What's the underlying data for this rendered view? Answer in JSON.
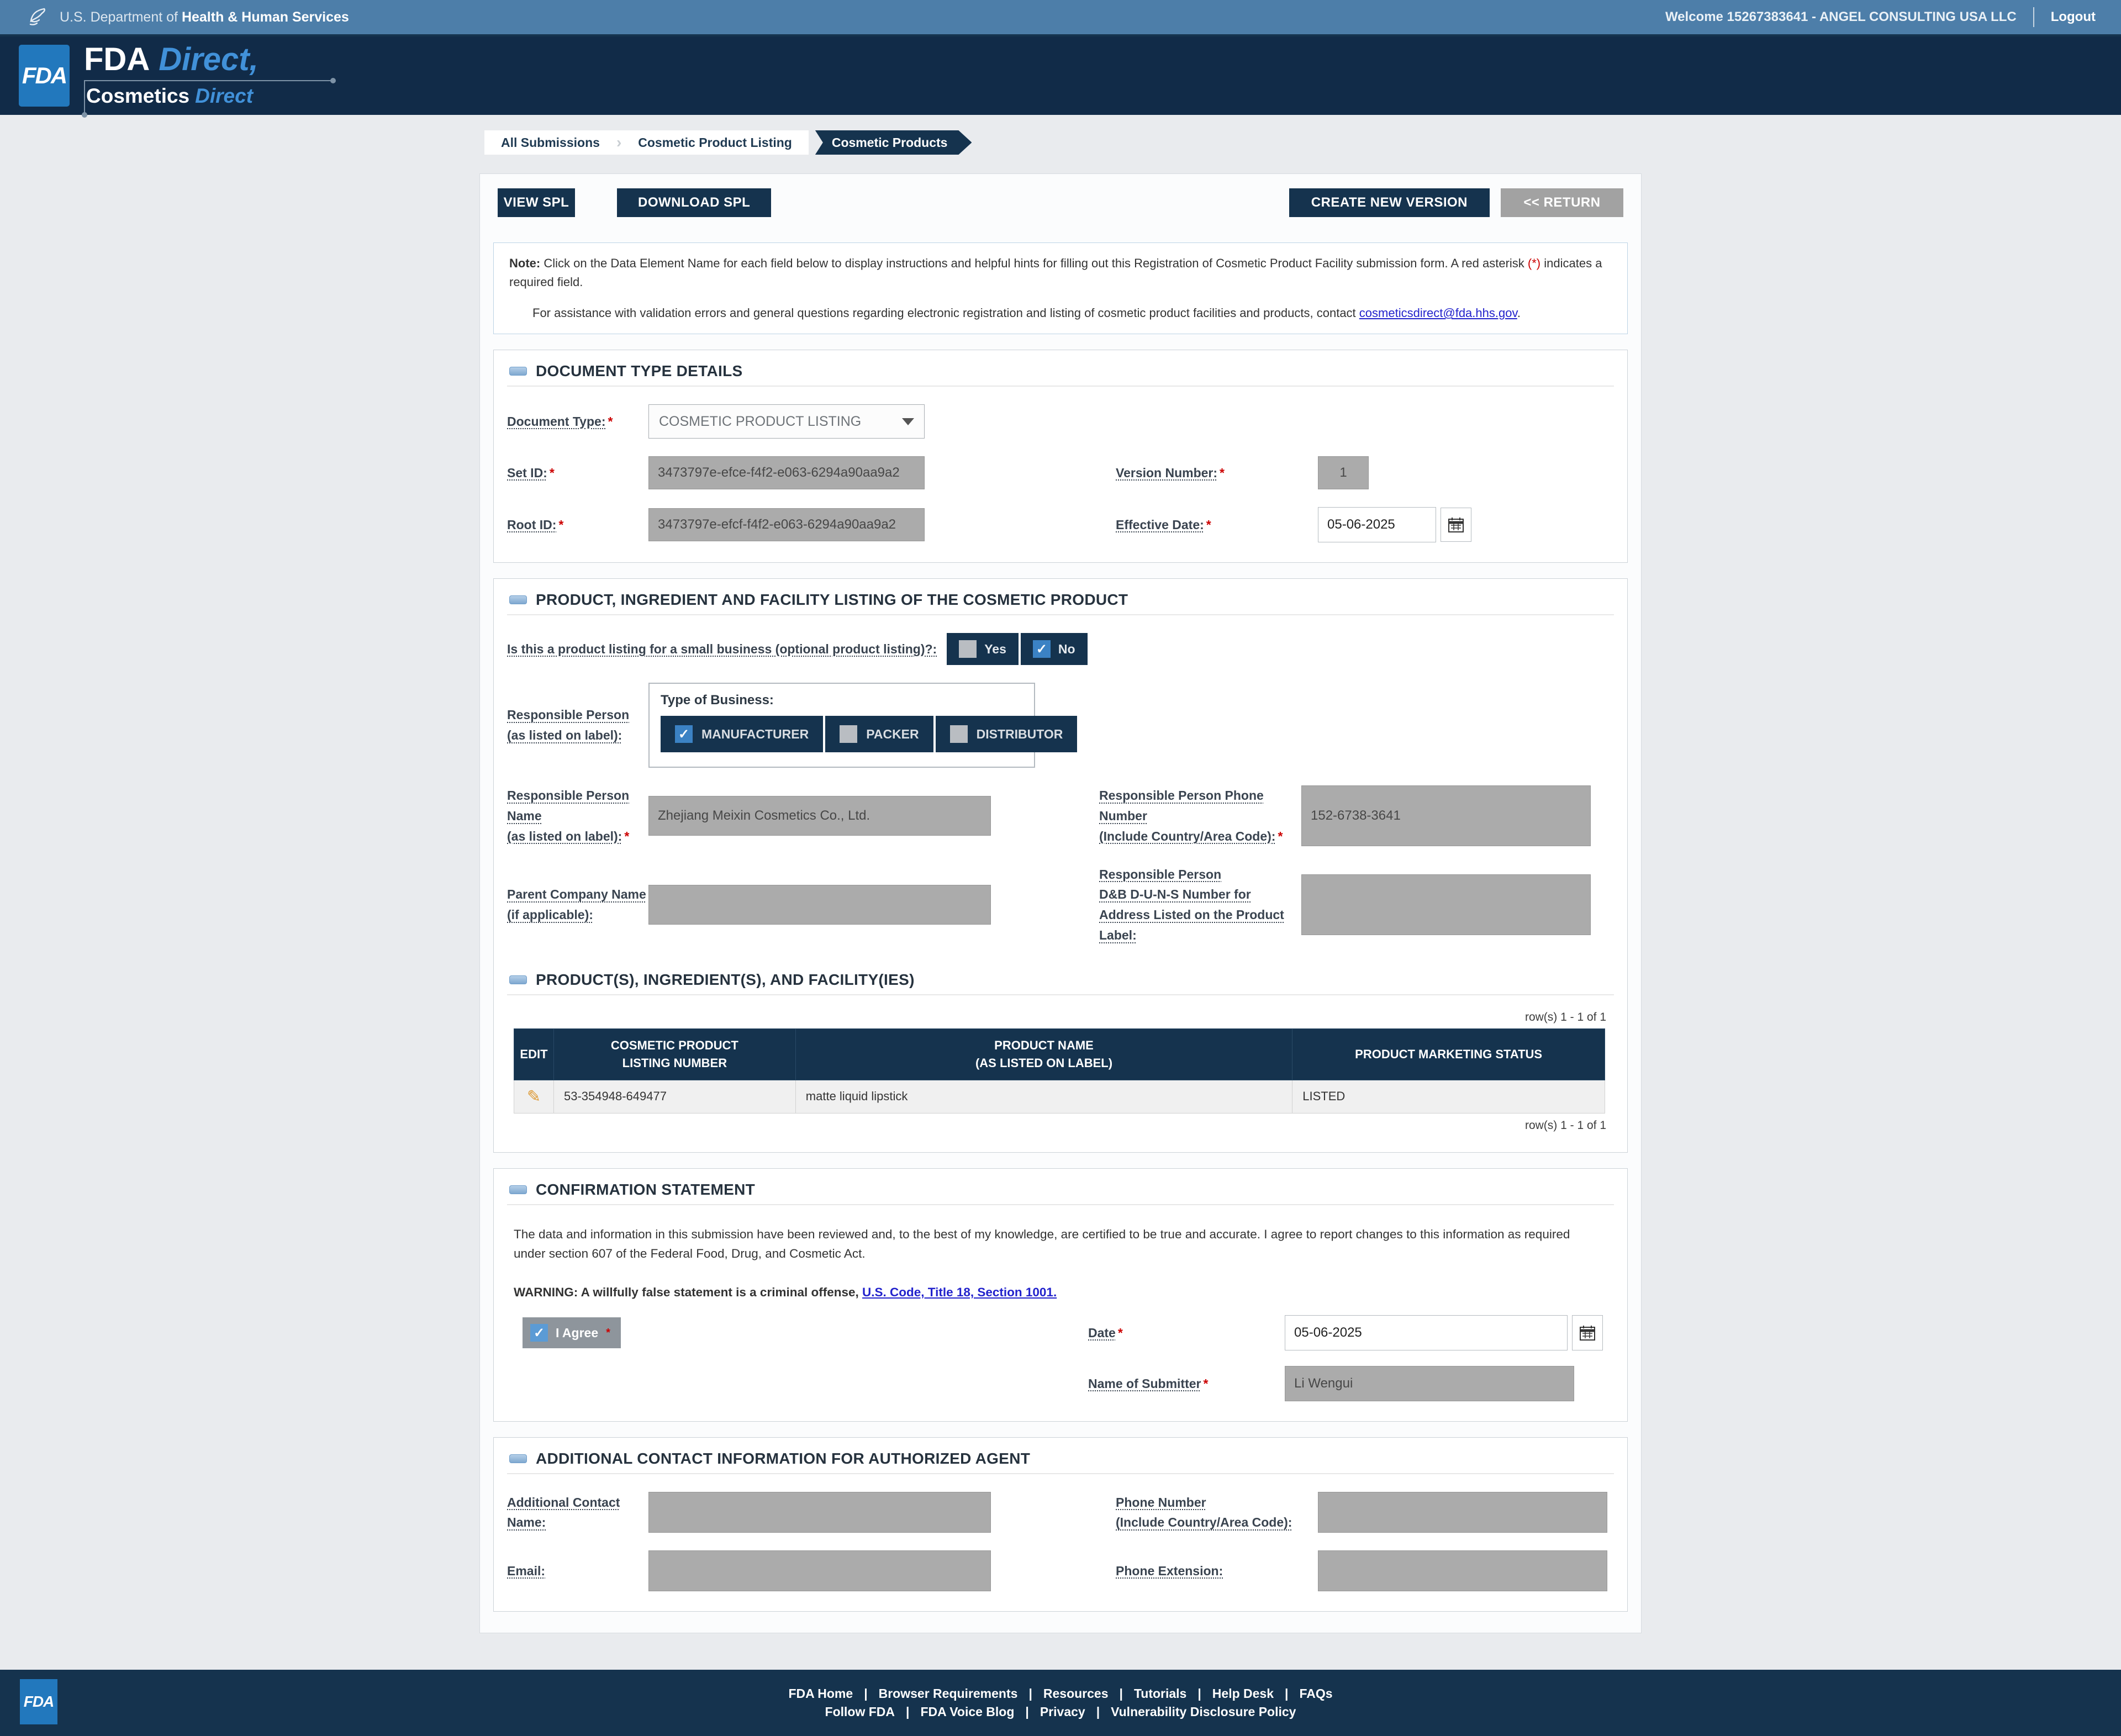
{
  "topbar": {
    "dept_prefix": "U.S. Department of",
    "dept_bold": "Health & Human Services",
    "welcome": "Welcome 15267383641 - ANGEL CONSULTING USA LLC",
    "logout": "Logout"
  },
  "brand": {
    "logo": "FDA",
    "title_main": "FDA",
    "title_direct": "Direct,",
    "subtitle_main": "Cosmetics",
    "subtitle_direct": "Direct"
  },
  "crumbs": {
    "all": "All Submissions",
    "listing": "Cosmetic Product Listing",
    "active": "Cosmetic Products",
    "sep": "›"
  },
  "toolbar": {
    "view": "VIEW SPL",
    "download": "DOWNLOAD SPL",
    "create": "CREATE NEW VERSION",
    "return": "<< RETURN"
  },
  "note": {
    "prefix": "Note:",
    "body1": " Click on the Data Element Name for each field below to display instructions and helpful hints for filling out this Registration of Cosmetic Product Facility submission form. A red asterisk ",
    "red": "(*)",
    "body2": " indicates a required field.",
    "help": "For assistance with validation errors and general questions regarding electronic registration and listing of cosmetic product facilities and products, contact ",
    "help_link": "cosmeticsdirect@fda.hhs.gov",
    "dot": "."
  },
  "doc": {
    "title": "DOCUMENT TYPE DETAILS",
    "document_type": {
      "label": "Document Type:",
      "value": "COSMETIC PRODUCT LISTING"
    },
    "set_id": {
      "label": "Set ID:",
      "value": "3473797e-efce-f4f2-e063-6294a90aa9a2"
    },
    "version": {
      "label": "Version Number:",
      "value": "1"
    },
    "root_id": {
      "label": "Root ID:",
      "value": "3473797e-efcf-f4f2-e063-6294a90aa9a2"
    },
    "effective_date": {
      "label": "Effective Date:",
      "value": "05-06-2025"
    }
  },
  "product": {
    "title": "PRODUCT, INGREDIENT AND FACILITY LISTING OF THE COSMETIC PRODUCT",
    "small_business_q": "Is this a product listing for a small business (optional product listing)?:",
    "yes": "Yes",
    "no": "No",
    "rp_label": "Responsible Person\n(as listed on label):",
    "tob_label": "Type of Business:",
    "manufacturer": "MANUFACTURER",
    "packer": "PACKER",
    "distributor": "DISTRIBUTOR",
    "rp_name": {
      "label": "Responsible Person\nName\n(as listed on label):",
      "value": "Zhejiang Meixin Cosmetics Co., Ltd."
    },
    "rp_phone": {
      "label": "Responsible Person Phone\nNumber\n(Include Country/Area Code):",
      "value": "152-6738-3641"
    },
    "parent_company": {
      "label": "Parent Company Name\n(if applicable):",
      "value": ""
    },
    "duns": {
      "label": "Responsible Person\nD&B D-U-N-S Number for\nAddress Listed on the Product\nLabel:",
      "value": ""
    }
  },
  "grid": {
    "title": "PRODUCT(S), INGREDIENT(S), AND FACILITY(IES)",
    "rows_label": "row(s) 1 - 1 of 1",
    "headers": [
      "EDIT",
      "COSMETIC PRODUCT\nLISTING NUMBER",
      "PRODUCT NAME\n(AS LISTED ON LABEL)",
      "PRODUCT MARKETING STATUS"
    ],
    "row": {
      "listing_number": "53-354948-649477",
      "product_name": "matte liquid lipstick",
      "marketing_status": "LISTED"
    }
  },
  "confirm": {
    "title": "CONFIRMATION STATEMENT",
    "body": "The data and information in this submission have been reviewed and, to the best of my knowledge, are certified to be true and accurate. I agree to report changes to this information as required under section 607 of the Federal Food, Drug, and Cosmetic Act.",
    "warning": "WARNING: A willfully false statement is a criminal offense, ",
    "warning_link": "U.S. Code, Title 18, Section 1001.",
    "agree": "I Agree",
    "date": {
      "label": "Date",
      "value": "05-06-2025"
    },
    "submitter": {
      "label": "Name of Submitter",
      "value": "Li Wengui"
    }
  },
  "contact": {
    "title": "ADDITIONAL CONTACT INFORMATION FOR AUTHORIZED AGENT",
    "name": {
      "label": "Additional Contact\nName:",
      "value": ""
    },
    "phone": {
      "label": "Phone Number\n(Include Country/Area Code):",
      "value": ""
    },
    "email": {
      "label": "Email:",
      "value": ""
    },
    "ext": {
      "label": "Phone Extension:",
      "value": ""
    }
  },
  "footer": {
    "row1": [
      "FDA Home",
      "Browser Requirements",
      "Resources",
      "Tutorials",
      "Help Desk",
      "FAQs"
    ],
    "row2": [
      "Follow FDA",
      "FDA Voice Blog",
      "Privacy",
      "Vulnerability Disclosure Policy"
    ],
    "sep": "|",
    "logo": "FDA"
  },
  "misc": {
    "req": "*"
  },
  "icons": {
    "edit": "pencil",
    "calendar": "calendar",
    "check": "checkmark",
    "hhs": "eagle"
  },
  "colors": {
    "navy": "#15334e",
    "steel_blue": "#4d7ea9",
    "fda_blue": "#2278bd",
    "accent_blue": "#4191d9",
    "required_red": "#cc0000",
    "disabled_gray": "#ababab"
  }
}
